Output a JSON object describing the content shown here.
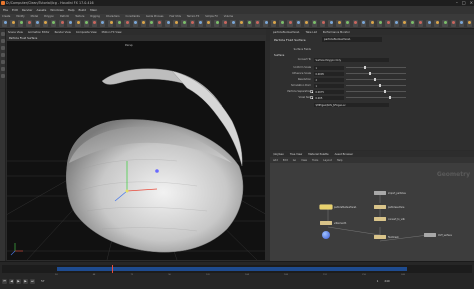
{
  "window": {
    "title": "D:/Computer/Clean/Tutorial/Icg - Houdini FX 17.0.416"
  },
  "menubar": {
    "items": [
      "File",
      "Edit",
      "Render",
      "Assets",
      "Windows",
      "Help",
      "Build",
      "Main"
    ]
  },
  "shelf": {
    "tabs": [
      "Create",
      "Modify",
      "Model",
      "Polygon",
      "Deform",
      "Texture",
      "Rigging",
      "Characters",
      "Constraints",
      "Guide Process",
      "Hair Utils",
      "Terrain FX",
      "Simple FX",
      "Volume",
      "Lights and Cameras",
      "Collisions",
      "Particles",
      "Grains",
      "Rigid Bodies",
      "Particle Fluids",
      "Viscous Fluids",
      "Oceans",
      "Fluid Containers",
      "Populate Containers",
      "Container Tools",
      "Pyro FX"
    ]
  },
  "viewport": {
    "tabs": [
      "Scene View",
      "Animation Editor",
      "Render View",
      "Composite View",
      "Motion FX View"
    ],
    "path": "Particle Fluid Surface",
    "camera_label": "Persp",
    "colors": {
      "shell": "#c8c8c8",
      "grid": "#3a3a3a",
      "background": "#111111"
    }
  },
  "parameters": {
    "tabs": [
      "particlefluidsurface1",
      "Take List",
      "Performance Monitor"
    ],
    "node_type": "Particle Fluid Surface",
    "node_name": "particlefluidsurface1",
    "rows": [
      {
        "label": "Surface Fields",
        "value": ""
      },
      {
        "label": "Convert To",
        "value": "Surface Polygon Only"
      },
      {
        "label": "Uniform Scale",
        "value": "1"
      },
      {
        "label": "Influence Scale",
        "value": "0.0005"
      },
      {
        "label": "Resolution",
        "value": "2"
      },
      {
        "label": "Simulation Dom",
        "value": "1"
      },
      {
        "label": "Particle Separation",
        "value": "0.0075"
      },
      {
        "label": "Voxel Size",
        "value": "0.005"
      }
    ],
    "section_label": "Surface",
    "file_field": "$HIP/geo/$OS_$F.bgeo.sc"
  },
  "network": {
    "tabs": [
      "/obj/Geo",
      "Tree View",
      "Material Palette",
      "Asset Browser"
    ],
    "menu": [
      "Add",
      "Edit",
      "Go",
      "View",
      "Tools",
      "Layout",
      "Help"
    ],
    "context_label": "Geometry",
    "nodes": [
      {
        "name": "import_particles",
        "style": "grey"
      },
      {
        "name": "particlefluidsurface1",
        "style": "selected"
      },
      {
        "name": "particlesurface",
        "style": "yellow"
      },
      {
        "name": "convert_to_vdb",
        "style": "yellow"
      },
      {
        "name": "vdbsmooth",
        "style": "yellow"
      },
      {
        "name": "fluidmesh",
        "style": "yellow"
      },
      {
        "name": "OUT_surface",
        "style": "grey"
      }
    ]
  },
  "timeline": {
    "start_frame": "1",
    "current_frame": "57",
    "end_frame": "240",
    "ticks": [
      "24",
      "48",
      "72",
      "96",
      "120",
      "144",
      "168",
      "192",
      "216",
      "240"
    ]
  }
}
